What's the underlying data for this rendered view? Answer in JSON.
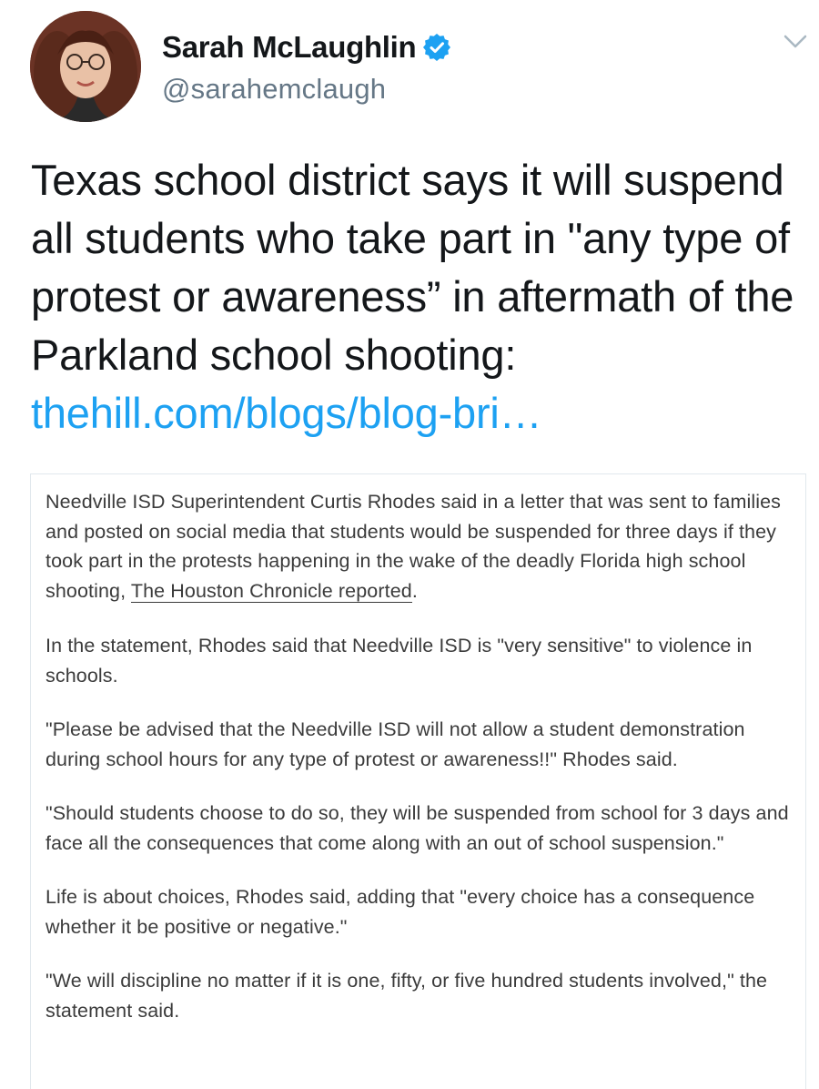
{
  "author": {
    "display_name": "Sarah McLaughlin",
    "handle": "@sarahemclaugh",
    "verified": true,
    "avatar_icon": "profile-photo-woman-glasses"
  },
  "tweet": {
    "text": "Texas school district says it will suspend all students who take part in \"any type of protest or awareness” in aftermath of the Parkland school shooting: ",
    "link_text": "thehill.com/blogs/blog-bri…"
  },
  "article": {
    "p1_before": "Needville ISD Superintendent Curtis Rhodes said in a letter that was sent to families and posted on social media that students would be suspended for three days if they took part in the protests happening in the wake of the deadly Florida high school shooting, ",
    "p1_link": "The Houston Chronicle reported",
    "p1_after": ".",
    "p2": "In the statement, Rhodes said that Needville ISD is \"very sensitive\" to violence in schools.",
    "p3": "\"Please be advised that the Needville ISD will not allow a student demonstration during school hours for any type of protest or awareness!!\" Rhodes said.",
    "p4": "\"Should students choose to do so, they will be suspended from school for 3 days and face all the consequences that come along with an out of school suspension.\"",
    "p5": "Life is about choices, Rhodes said, adding that \"every choice has a consequence whether it be positive or negative.\"",
    "p6": "\"We will discipline no matter if it is one, fifty, or five hundred students involved,\" the statement said."
  },
  "colors": {
    "link_blue": "#1da1f2",
    "verified_blue": "#1da1f2",
    "handle_gray": "#657786",
    "card_border": "#e1e8ed"
  },
  "icons": {
    "verified": "verified-badge-icon",
    "menu": "chevron-down-icon"
  }
}
